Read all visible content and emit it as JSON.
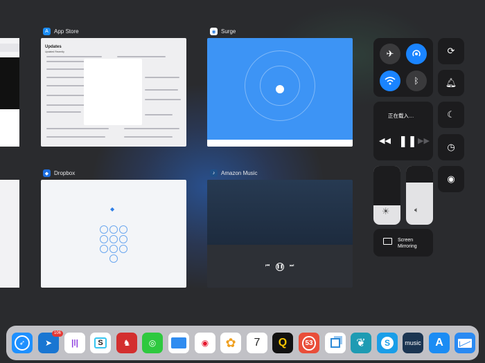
{
  "switcher": {
    "apps": [
      {
        "id": "app-store",
        "title": "App Store",
        "screen_heading": "Updates",
        "screen_subheading": "Updated Recently"
      },
      {
        "id": "surge",
        "title": "Surge"
      },
      {
        "id": "dropbox",
        "title": "Dropbox"
      },
      {
        "id": "amazon-music",
        "title": "Amazon Music"
      }
    ]
  },
  "control_center": {
    "now_playing": {
      "title": "正在载入…"
    },
    "screen_mirroring": {
      "label_line1": "Screen",
      "label_line2": "Mirroring"
    },
    "toggles": {
      "airplane_mode": "off",
      "airdrop": "on",
      "wifi": "on",
      "bluetooth": "off",
      "rotation_lock": "off",
      "silent": "off",
      "do_not_disturb": "off"
    },
    "brightness_level": 0.33,
    "volume_level": 0.72,
    "accent_color": "#1a84ff"
  },
  "dock": {
    "apps": [
      {
        "name": "Safari",
        "icon": "safari-icon"
      },
      {
        "name": "Spark",
        "icon": "spark-icon",
        "badge": "106"
      },
      {
        "name": "Siri Podcasts",
        "icon": "waveform-icon"
      },
      {
        "name": "Slack",
        "icon": "slack-icon"
      },
      {
        "name": "Chess",
        "icon": "knight-icon"
      },
      {
        "name": "WeChat",
        "icon": "wechat-icon"
      },
      {
        "name": "Files",
        "icon": "folder-icon"
      },
      {
        "name": "Weibo",
        "icon": "weibo-icon"
      },
      {
        "name": "Photos",
        "icon": "photos-icon"
      },
      {
        "name": "Calendar",
        "icon": "calendar-icon",
        "day": "7"
      },
      {
        "name": "Q",
        "icon": "q-icon"
      },
      {
        "name": "53",
        "icon": "53-icon"
      },
      {
        "name": "Screen Capture",
        "icon": "squares-icon"
      },
      {
        "name": "MindNode",
        "icon": "tree-icon"
      },
      {
        "name": "Skype",
        "icon": "skype-icon"
      },
      {
        "name": "Amazon Music",
        "icon": "amazon-music-icon",
        "label": "music"
      },
      {
        "name": "App Store",
        "icon": "app-store-icon"
      },
      {
        "name": "Mail",
        "icon": "mail-icon"
      }
    ]
  }
}
